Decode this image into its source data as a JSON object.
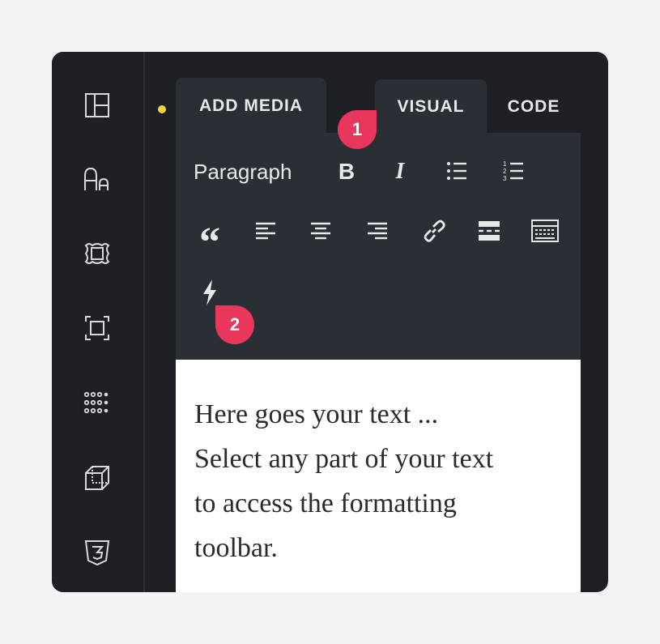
{
  "tabs": {
    "add_media": "ADD MEDIA",
    "visual": "VISUAL",
    "code": "CODE"
  },
  "toolbar": {
    "paragraph_label": "Paragraph",
    "bold_label": "B",
    "italic_label": "I",
    "quote_label": "“"
  },
  "content": {
    "lines": [
      "Here goes your text ...",
      "Select any part of your text",
      "to access the formatting",
      "toolbar."
    ]
  },
  "badges": {
    "first": "1",
    "second": "2"
  },
  "sidebar": {
    "icons": [
      "layout-icon",
      "typography-icon",
      "border-icon",
      "spacing-icon",
      "grid-icon",
      "transform-icon",
      "css3-icon"
    ]
  },
  "colors": {
    "accent_badge": "#e8365d",
    "status_dot": "#f5d33b",
    "panel_bg": "#1d2024",
    "toolbar_bg": "#2a2f36"
  }
}
